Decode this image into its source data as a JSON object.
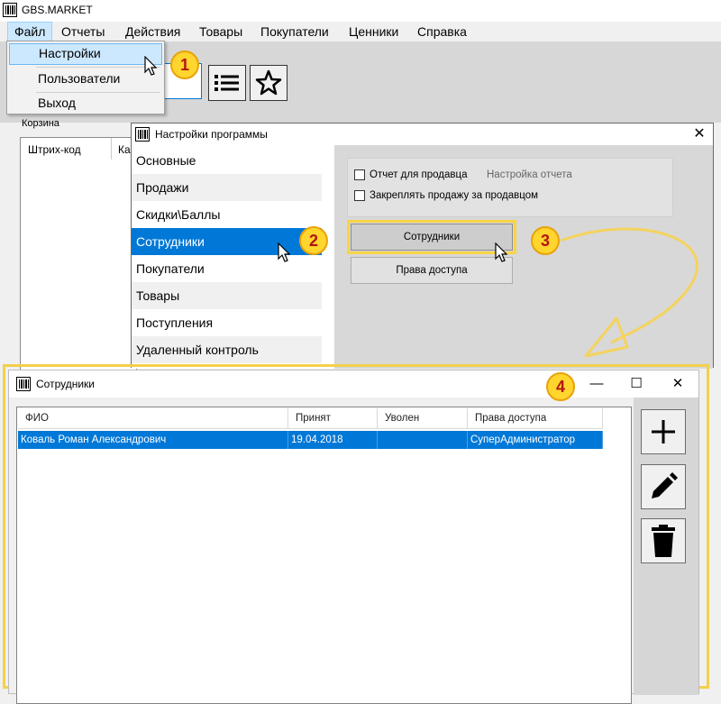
{
  "app": {
    "title": "GBS.MARKET",
    "menu": [
      "Файл",
      "Отчеты",
      "Действия",
      "Товары",
      "Покупатели",
      "Ценники",
      "Справка"
    ],
    "file_menu": [
      "Настройки",
      "Пользователи",
      "Выход"
    ],
    "cart": {
      "label": "Корзина",
      "col_barcode": "Штрих-код",
      "col_partial": "Ка"
    }
  },
  "settings": {
    "title": "Настройки программы",
    "close": "✕",
    "nav": [
      "Основные",
      "Продажи",
      "Скидки\\Баллы",
      "Сотрудники",
      "Покупатели",
      "Товары",
      "Поступления",
      "Удаленный контроль"
    ],
    "selected": "Сотрудники",
    "options": {
      "report_for_seller": "Отчет для продавца",
      "report_setup": "Настройка отчета",
      "bind_sale_to_seller": "Закреплять продажу за продавцом"
    },
    "buttons": {
      "employees": "Сотрудники",
      "access_rights": "Права доступа"
    }
  },
  "employees": {
    "title": "Сотрудники",
    "controls": {
      "minimize": "—",
      "maximize": "☐",
      "close": "✕"
    },
    "columns": [
      "ФИО",
      "Принят",
      "Уволен",
      "Права доступа"
    ],
    "rows": [
      [
        "Коваль Роман Александрович",
        "19.04.2018",
        "",
        "СуперАдминистратор"
      ]
    ]
  },
  "badges": [
    "1",
    "2",
    "3",
    "4"
  ],
  "colors": {
    "accent": "#0078d7",
    "badge_fill": "#ffd52e",
    "badge_text": "#b3150f",
    "highlight_border": "#f2d04c"
  },
  "icons": [
    "barcode-logo-icon",
    "list-icon",
    "star-icon",
    "plus-icon",
    "pencil-icon",
    "trash-icon",
    "cursor-icon"
  ]
}
